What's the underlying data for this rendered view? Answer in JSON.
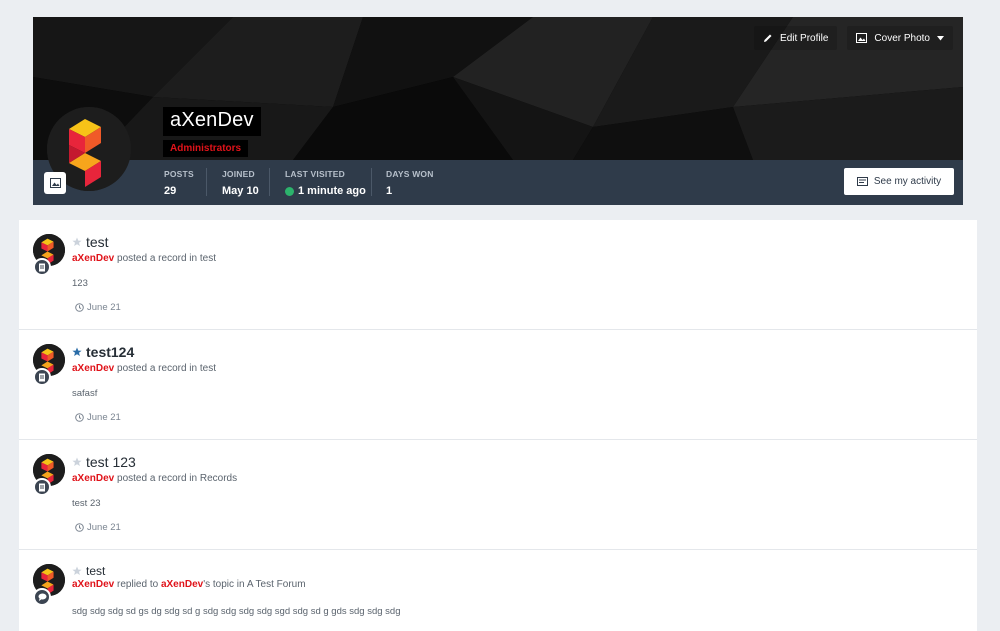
{
  "profile": {
    "username": "aXenDev",
    "group": "Administrators",
    "actions": {
      "edit_profile": "Edit Profile",
      "cover_photo": "Cover Photo"
    },
    "stats": [
      {
        "label": "Posts",
        "value": "29"
      },
      {
        "label": "Joined",
        "value": "May 10"
      },
      {
        "label": "Last Visited",
        "value": "1 minute ago"
      },
      {
        "label": "Days Won",
        "value": "1"
      }
    ],
    "see_activity": "See my activity"
  },
  "feed": [
    {
      "title": "test",
      "starred": false,
      "author": "aXenDev",
      "action": "posted a record in",
      "location": "test",
      "body": "123",
      "time": "June 21",
      "icon": "document-icon"
    },
    {
      "title": "test124",
      "starred": true,
      "author": "aXenDev",
      "action": "posted a record in",
      "location": "test",
      "body": "safasf",
      "time": "June 21",
      "icon": "document-icon"
    },
    {
      "title": "test 123",
      "starred": false,
      "author": "aXenDev",
      "action": "posted a record in",
      "location": "Records",
      "body": "test 23",
      "time": "June 21",
      "icon": "document-icon"
    },
    {
      "title": "test",
      "starred": false,
      "author": "aXenDev",
      "action": "replied to",
      "target_author": "aXenDev",
      "target_suffix": "'s topic in",
      "location": "A Test Forum",
      "body": "sdg sdg sdg sd gs dg sdg sd g sdg sdg sdg sdg sgd sdg sd g gds sdg sdg sdg",
      "icon": "comment-icon"
    }
  ],
  "colors": {
    "accent": "#e0131a",
    "stats_bar": "#2f3b4a",
    "online": "#2cb36c"
  }
}
